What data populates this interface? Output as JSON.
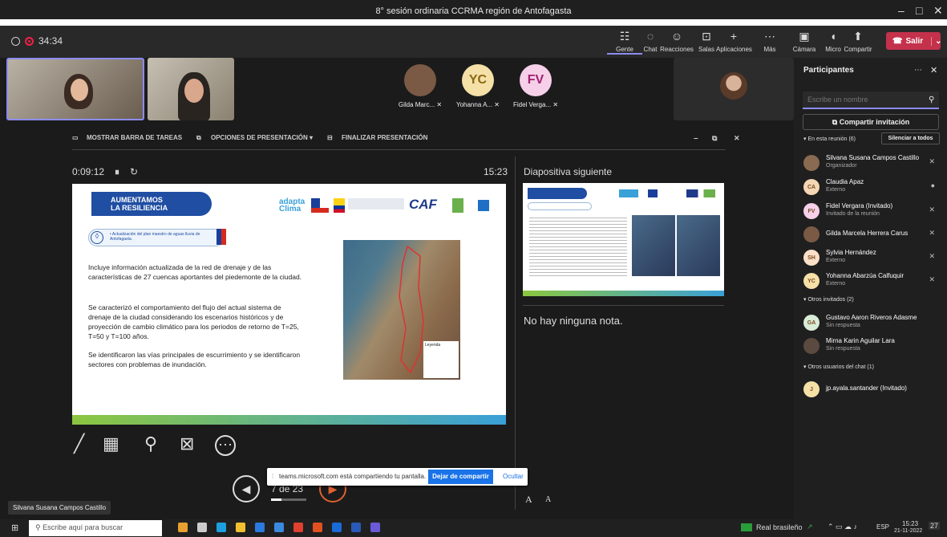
{
  "window": {
    "title": "8° sesión ordinaria CCRMA región de Antofagasta"
  },
  "call": {
    "duration": "34:34"
  },
  "toolbar": [
    {
      "label": "Gente",
      "icon": "people-icon"
    },
    {
      "label": "Chat",
      "icon": "chat-icon"
    },
    {
      "label": "Reacciones",
      "icon": "reactions-icon"
    },
    {
      "label": "Salas",
      "icon": "rooms-icon"
    },
    {
      "label": "Aplicaciones",
      "icon": "apps-icon"
    },
    {
      "label": "Más",
      "icon": "more-icon"
    },
    {
      "label": "Cámara",
      "icon": "camera-off-icon"
    },
    {
      "label": "Micro",
      "icon": "mic-icon"
    },
    {
      "label": "Compartir",
      "icon": "share-icon"
    }
  ],
  "leave_label": "Salir",
  "top_participants": [
    {
      "name": "Gilda Marc...",
      "initials": "",
      "color": "#7a5a45"
    },
    {
      "name": "Yohanna A...",
      "initials": "YC",
      "color": "#f5e0a8"
    },
    {
      "name": "Fidel Verga...",
      "initials": "FV",
      "color": "#f5d0e8"
    }
  ],
  "presentation_bar": {
    "taskbar": "MOSTRAR BARRA DE TAREAS",
    "options": "OPCIONES DE PRESENTACIÓN ▾",
    "end": "FINALIZAR PRESENTACIÓN"
  },
  "presenter": {
    "elapsed": "0:09:12",
    "clock": "15:23",
    "next_label": "Diapositiva siguiente",
    "notes": "No hay ninguna nota.",
    "slide_counter": "7 de 23"
  },
  "slide": {
    "banner": "AUMENTAMOS\nLA RESILIENCIA",
    "logo_text": "adapta\nClima",
    "logo2": "CAF",
    "subtitle": "• Actualización del plan maestro de aguas lluvia de Antofagasta.",
    "p1": "Incluye información actualizada de la red de drenaje y de las características de 27 cuencas aportantes del piedemonte de la ciudad.",
    "p2": "Se caracterizó el comportamiento del flujo del actual sistema de drenaje de la ciudad considerando los escenarios históricos y de proyección de cambio climático para los periodos de retorno de T=25, T=50 y T=100 años.",
    "p3": "Se identificaron las vías principales de escurrimiento y se identificaron sectores con problemas de inundación.",
    "legend": "Leyenda"
  },
  "share_notice": {
    "text": "teams.microsoft.com está compartiendo tu pantalla.",
    "stop": "Dejar de compartir",
    "hide": "Ocultar"
  },
  "presenter_name": "Silvana Susana Campos Castillo",
  "sidebar": {
    "title": "Participantes",
    "search_placeholder": "Escribe un nombre",
    "invite": "Compartir invitación",
    "in_meeting": "En esta reunión (6)",
    "mute_all": "Silenciar a todos",
    "others_invited": "Otros invitados (2)",
    "others_chat": "Otros usuarios del chat (1)",
    "in_meeting_list": [
      {
        "name": "Silvana Susana Campos Castillo",
        "role": "Organizador",
        "initials": "",
        "color": "#8a6a50",
        "mic": "mic-off-icon"
      },
      {
        "name": "Claudia Apaz",
        "role": "Externo",
        "initials": "CA",
        "color": "#f5d7b5",
        "mic": "mic-icon"
      },
      {
        "name": "Fidel Vergara (Invitado)",
        "role": "Invitado de la reunión",
        "initials": "FV",
        "color": "#f5d0e8",
        "mic": "mic-off-icon"
      },
      {
        "name": "Gilda Marcela Herrera Carus",
        "role": "",
        "initials": "",
        "color": "#7a5a45",
        "mic": "mic-off-icon"
      },
      {
        "name": "Sylvia Hernández",
        "role": "Externo",
        "initials": "SH",
        "color": "#fde0c8",
        "mic": "mic-off-icon"
      },
      {
        "name": "Yohanna Abarzúa Calfuquir",
        "role": "Externo",
        "initials": "YC",
        "color": "#f5e0a8",
        "mic": "mic-off-icon"
      }
    ],
    "invited_list": [
      {
        "name": "Gustavo Aaron Riveros Adasme",
        "role": "Sin respuesta",
        "initials": "GA",
        "color": "#d8ecd8"
      },
      {
        "name": "Mirna Karin Aguilar Lara",
        "role": "Sin respuesta",
        "initials": "",
        "color": "#5a4a40"
      }
    ],
    "chat_list": [
      {
        "name": "jp.ayala.santander (Invitado)",
        "initials": "J",
        "color": "#f5e0a8"
      }
    ]
  },
  "taskbar": {
    "search_placeholder": "Escribe aquí para buscar",
    "currency": "Real brasileño",
    "lang": "ESP",
    "time": "15:23",
    "date": "21-11-2022",
    "notif": "27"
  }
}
